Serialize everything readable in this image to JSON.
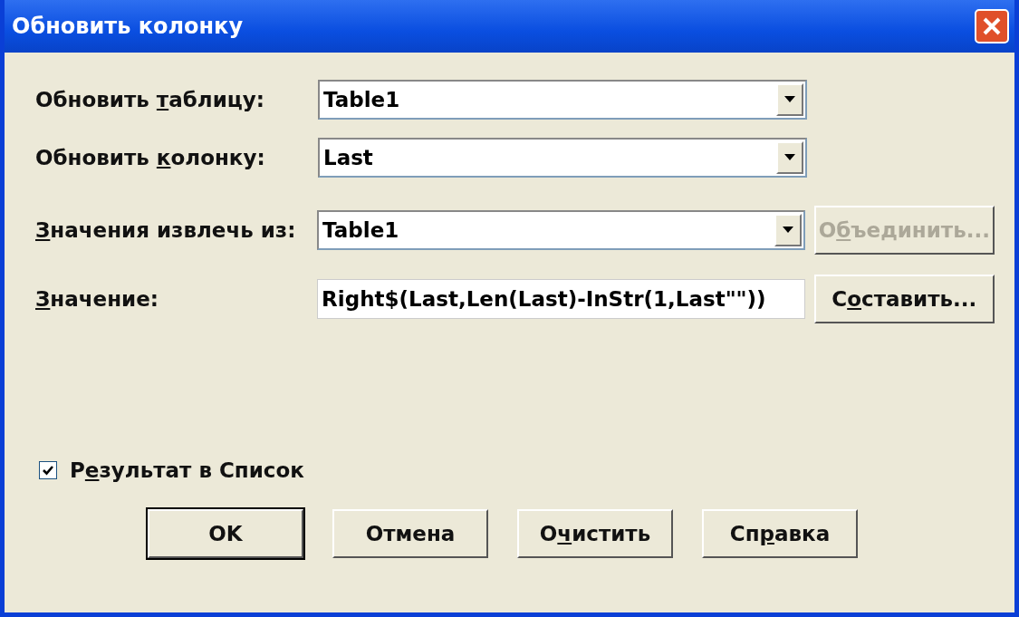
{
  "window": {
    "title": "Обновить колонку"
  },
  "fields": [
    {
      "kind": "combo",
      "label_before": "Обновить ",
      "access_key": "т",
      "label_after": "аблицу:",
      "value": "Table1"
    },
    {
      "kind": "combo",
      "label_before": "Обновить ",
      "access_key": "к",
      "label_after": "олонку:",
      "value": "Last"
    },
    {
      "kind": "combo",
      "access_key": "З",
      "label_after": "начения извлечь из:",
      "value": "Table1",
      "button": {
        "before": "О",
        "access_key": "б",
        "after": "ъединить...",
        "disabled": true
      }
    },
    {
      "kind": "text",
      "access_key": "З",
      "label_after": "начение:",
      "value": "Right$(Last,Len(Last)-InStr(1,Last\"\"))",
      "button": {
        "before": "С",
        "access_key": "о",
        "after": "ставить...",
        "disabled": false
      }
    }
  ],
  "checkbox": {
    "before": "Р",
    "access_key": "е",
    "after": "зультат в Список",
    "checked": true
  },
  "buttons": [
    {
      "before": "OK",
      "default": true
    },
    {
      "before": "Отмена",
      "default": false
    },
    {
      "before": "О",
      "access_key": "ч",
      "after": "истить",
      "default": false
    },
    {
      "before": "Сп",
      "access_key": "р",
      "after": "авка",
      "default": false
    }
  ]
}
